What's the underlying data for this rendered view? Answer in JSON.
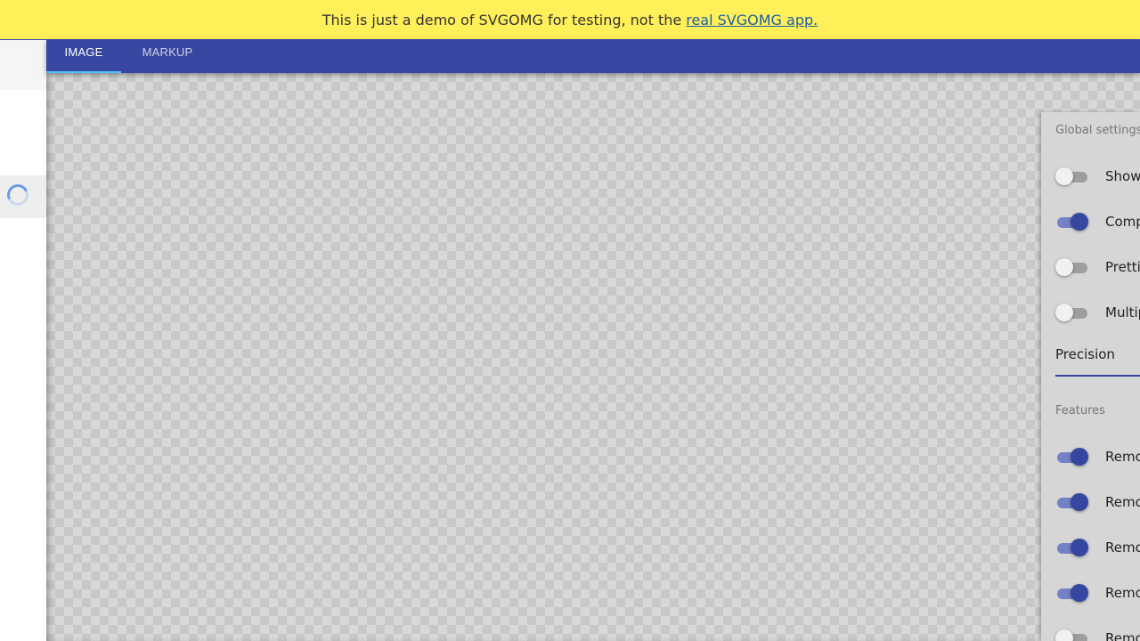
{
  "banner": {
    "text": "This is just a demo of SVGOMG for testing, not the",
    "link_text": "real SVGOMG app."
  },
  "tabs": [
    {
      "label": "IMAGE",
      "active": true
    },
    {
      "label": "MARKUP",
      "active": false
    }
  ],
  "settings": {
    "global_title": "Global settings",
    "global_items": [
      {
        "label": "Show",
        "on": false
      },
      {
        "label": "Comp",
        "on": true
      },
      {
        "label": "Prettif",
        "on": false
      },
      {
        "label": "Multip",
        "on": false
      }
    ],
    "precision_label": "Precision",
    "features_title": "Features",
    "feature_items": [
      {
        "label": "Remo",
        "on": true
      },
      {
        "label": "Remo",
        "on": true
      },
      {
        "label": "Remo",
        "on": true
      },
      {
        "label": "Remo",
        "on": true
      },
      {
        "label": "Remo",
        "on": false
      }
    ]
  },
  "colors": {
    "banner_bg": "#fff05a",
    "toolbar_bg": "#3746a0",
    "accent": "#3746a0",
    "link": "#1e5fa8"
  },
  "icons": {
    "loader": "loading-spinner-icon"
  }
}
